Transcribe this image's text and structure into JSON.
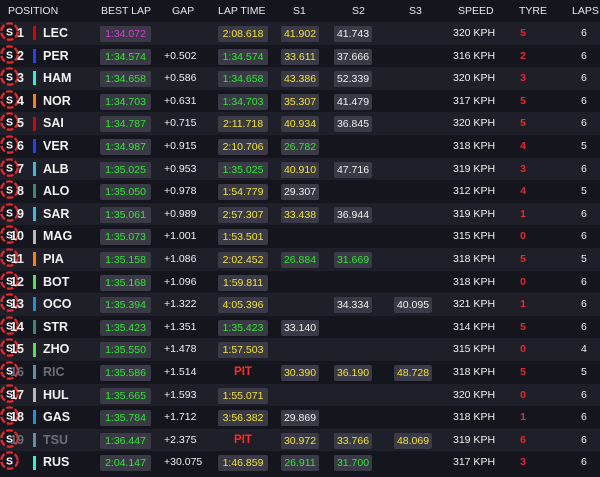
{
  "headers": {
    "position": "POSITION",
    "best_lap": "BEST LAP",
    "gap": "GAP",
    "lap_time": "LAP TIME",
    "s1": "S1",
    "s2": "S2",
    "s3": "S3",
    "speed": "SPEED",
    "tyre": "TYRE",
    "laps": "LAPS"
  },
  "colors": {
    "purple": "#d93bdb",
    "green": "#2ee82e",
    "yellow": "#f2e230",
    "white": "#f0f0f0",
    "pit": "#ff2a2a",
    "tyre_soft": "#e8282b"
  },
  "rows": [
    {
      "pos": "1",
      "code": "LEC",
      "team": "#dc0000",
      "best": "1:34.072",
      "best_c": "purple",
      "gap": "",
      "lt": "2:08.618",
      "lt_c": "yellow",
      "s1": "41.902",
      "s1_c": "yellow",
      "s2": "41.743",
      "s2_c": "white",
      "s3": "",
      "s3_c": "",
      "speed": "320 KPH",
      "tl": "5",
      "tyre": "S",
      "laps": "6",
      "pit": false,
      "dim": false
    },
    {
      "pos": "2",
      "code": "PER",
      "team": "#1e41ff",
      "best": "1:34.574",
      "best_c": "green",
      "gap": "+0.502",
      "lt": "1:34.574",
      "lt_c": "green",
      "s1": "33.611",
      "s1_c": "yellow",
      "s2": "37.666",
      "s2_c": "white",
      "s3": "",
      "s3_c": "",
      "speed": "316 KPH",
      "tl": "2",
      "tyre": "S",
      "laps": "6",
      "pit": false,
      "dim": false
    },
    {
      "pos": "3",
      "code": "HAM",
      "team": "#27f4d2",
      "best": "1:34.658",
      "best_c": "green",
      "gap": "+0.586",
      "lt": "1:34.658",
      "lt_c": "green",
      "s1": "43.386",
      "s1_c": "yellow",
      "s2": "52.339",
      "s2_c": "white",
      "s3": "",
      "s3_c": "",
      "speed": "320 KPH",
      "tl": "3",
      "tyre": "S",
      "laps": "6",
      "pit": false,
      "dim": false
    },
    {
      "pos": "4",
      "code": "NOR",
      "team": "#ff8000",
      "best": "1:34.703",
      "best_c": "green",
      "gap": "+0.631",
      "lt": "1:34.703",
      "lt_c": "green",
      "s1": "35.307",
      "s1_c": "yellow",
      "s2": "41.479",
      "s2_c": "white",
      "s3": "",
      "s3_c": "",
      "speed": "317 KPH",
      "tl": "5",
      "tyre": "S",
      "laps": "6",
      "pit": false,
      "dim": false
    },
    {
      "pos": "5",
      "code": "SAI",
      "team": "#dc0000",
      "best": "1:34.787",
      "best_c": "green",
      "gap": "+0.715",
      "lt": "2:11.718",
      "lt_c": "yellow",
      "s1": "40.934",
      "s1_c": "yellow",
      "s2": "36.845",
      "s2_c": "white",
      "s3": "",
      "s3_c": "",
      "speed": "320 KPH",
      "tl": "5",
      "tyre": "S",
      "laps": "6",
      "pit": false,
      "dim": false
    },
    {
      "pos": "6",
      "code": "VER",
      "team": "#1e41ff",
      "best": "1:34.987",
      "best_c": "green",
      "gap": "+0.915",
      "lt": "2:10.706",
      "lt_c": "yellow",
      "s1": "26.782",
      "s1_c": "green",
      "s2": "",
      "s2_c": "",
      "s3": "",
      "s3_c": "",
      "speed": "318 KPH",
      "tl": "4",
      "tyre": "S",
      "laps": "5",
      "pit": false,
      "dim": false
    },
    {
      "pos": "7",
      "code": "ALB",
      "team": "#37bedd",
      "best": "1:35.025",
      "best_c": "green",
      "gap": "+0.953",
      "lt": "1:35.025",
      "lt_c": "green",
      "s1": "40.910",
      "s1_c": "yellow",
      "s2": "47.716",
      "s2_c": "white",
      "s3": "",
      "s3_c": "",
      "speed": "319 KPH",
      "tl": "3",
      "tyre": "S",
      "laps": "6",
      "pit": false,
      "dim": false
    },
    {
      "pos": "8",
      "code": "ALO",
      "team": "#358c75",
      "best": "1:35.050",
      "best_c": "green",
      "gap": "+0.978",
      "lt": "1:54.779",
      "lt_c": "yellow",
      "s1": "29.307",
      "s1_c": "white",
      "s2": "",
      "s2_c": "",
      "s3": "",
      "s3_c": "",
      "speed": "312 KPH",
      "tl": "4",
      "tyre": "S",
      "laps": "5",
      "pit": false,
      "dim": false
    },
    {
      "pos": "9",
      "code": "SAR",
      "team": "#37bedd",
      "best": "1:35.061",
      "best_c": "green",
      "gap": "+0.989",
      "lt": "2:57.307",
      "lt_c": "yellow",
      "s1": "33.438",
      "s1_c": "yellow",
      "s2": "36.944",
      "s2_c": "white",
      "s3": "",
      "s3_c": "",
      "speed": "319 KPH",
      "tl": "1",
      "tyre": "S",
      "laps": "6",
      "pit": false,
      "dim": false
    },
    {
      "pos": "10",
      "code": "MAG",
      "team": "#b6babd",
      "best": "1:35.073",
      "best_c": "green",
      "gap": "+1.001",
      "lt": "1:53.501",
      "lt_c": "yellow",
      "s1": "",
      "s1_c": "",
      "s2": "",
      "s2_c": "",
      "s3": "",
      "s3_c": "",
      "speed": "315 KPH",
      "tl": "0",
      "tyre": "S",
      "laps": "6",
      "pit": false,
      "dim": false
    },
    {
      "pos": "11",
      "code": "PIA",
      "team": "#ff8000",
      "best": "1:35.158",
      "best_c": "green",
      "gap": "+1.086",
      "lt": "2:02.452",
      "lt_c": "yellow",
      "s1": "26.884",
      "s1_c": "green",
      "s2": "31.669",
      "s2_c": "green",
      "s3": "",
      "s3_c": "",
      "speed": "318 KPH",
      "tl": "5",
      "tyre": "S",
      "laps": "5",
      "pit": false,
      "dim": false
    },
    {
      "pos": "12",
      "code": "BOT",
      "team": "#52e252",
      "best": "1:35.168",
      "best_c": "green",
      "gap": "+1.096",
      "lt": "1:59.811",
      "lt_c": "yellow",
      "s1": "",
      "s1_c": "",
      "s2": "",
      "s2_c": "",
      "s3": "",
      "s3_c": "",
      "speed": "318 KPH",
      "tl": "0",
      "tyre": "S",
      "laps": "6",
      "pit": false,
      "dim": false
    },
    {
      "pos": "13",
      "code": "OCO",
      "team": "#2293d1",
      "best": "1:35.394",
      "best_c": "green",
      "gap": "+1.322",
      "lt": "4:05.396",
      "lt_c": "yellow",
      "s1": "",
      "s1_c": "",
      "s2": "34.334",
      "s2_c": "white",
      "s3": "40.095",
      "s3_c": "white",
      "speed": "321 KPH",
      "tl": "1",
      "tyre": "S",
      "laps": "6",
      "pit": false,
      "dim": false
    },
    {
      "pos": "14",
      "code": "STR",
      "team": "#358c75",
      "best": "1:35.423",
      "best_c": "green",
      "gap": "+1.351",
      "lt": "1:35.423",
      "lt_c": "green",
      "s1": "33.140",
      "s1_c": "white",
      "s2": "",
      "s2_c": "",
      "s3": "",
      "s3_c": "",
      "speed": "314 KPH",
      "tl": "5",
      "tyre": "S",
      "laps": "6",
      "pit": false,
      "dim": false
    },
    {
      "pos": "15",
      "code": "ZHO",
      "team": "#52e252",
      "best": "1:35.550",
      "best_c": "green",
      "gap": "+1.478",
      "lt": "1:57.503",
      "lt_c": "yellow",
      "s1": "",
      "s1_c": "",
      "s2": "",
      "s2_c": "",
      "s3": "",
      "s3_c": "",
      "speed": "315 KPH",
      "tl": "0",
      "tyre": "S",
      "laps": "4",
      "pit": false,
      "dim": false
    },
    {
      "pos": "16",
      "code": "RIC",
      "team": "#5e8faa",
      "best": "1:35.586",
      "best_c": "green",
      "gap": "+1.514",
      "lt": "PIT",
      "lt_c": "",
      "s1": "30.390",
      "s1_c": "yellow",
      "s2": "36.190",
      "s2_c": "yellow",
      "s3": "48.728",
      "s3_c": "yellow",
      "speed": "318 KPH",
      "tl": "5",
      "tyre": "S",
      "laps": "5",
      "pit": true,
      "dim": true
    },
    {
      "pos": "17",
      "code": "HUL",
      "team": "#b6babd",
      "best": "1:35.665",
      "best_c": "green",
      "gap": "+1.593",
      "lt": "1:55.071",
      "lt_c": "yellow",
      "s1": "",
      "s1_c": "",
      "s2": "",
      "s2_c": "",
      "s3": "",
      "s3_c": "",
      "speed": "320 KPH",
      "tl": "0",
      "tyre": "S",
      "laps": "6",
      "pit": false,
      "dim": false
    },
    {
      "pos": "18",
      "code": "GAS",
      "team": "#2293d1",
      "best": "1:35.784",
      "best_c": "green",
      "gap": "+1.712",
      "lt": "3:56.382",
      "lt_c": "yellow",
      "s1": "29.869",
      "s1_c": "white",
      "s2": "",
      "s2_c": "",
      "s3": "",
      "s3_c": "",
      "speed": "318 KPH",
      "tl": "1",
      "tyre": "S",
      "laps": "6",
      "pit": false,
      "dim": false
    },
    {
      "pos": "19",
      "code": "TSU",
      "team": "#5e8faa",
      "best": "1:36.447",
      "best_c": "green",
      "gap": "+2.375",
      "lt": "PIT",
      "lt_c": "",
      "s1": "30.972",
      "s1_c": "yellow",
      "s2": "33.766",
      "s2_c": "yellow",
      "s3": "48.069",
      "s3_c": "yellow",
      "speed": "319 KPH",
      "tl": "6",
      "tyre": "S",
      "laps": "6",
      "pit": true,
      "dim": true
    },
    {
      "pos": "",
      "code": "RUS",
      "team": "#27f4d2",
      "best": "2:04.147",
      "best_c": "green",
      "gap": "+30.075",
      "lt": "1:46.859",
      "lt_c": "yellow",
      "s1": "26.911",
      "s1_c": "green",
      "s2": "31.700",
      "s2_c": "green",
      "s3": "",
      "s3_c": "",
      "speed": "317 KPH",
      "tl": "3",
      "tyre": "S",
      "laps": "6",
      "pit": false,
      "dim": false
    }
  ]
}
